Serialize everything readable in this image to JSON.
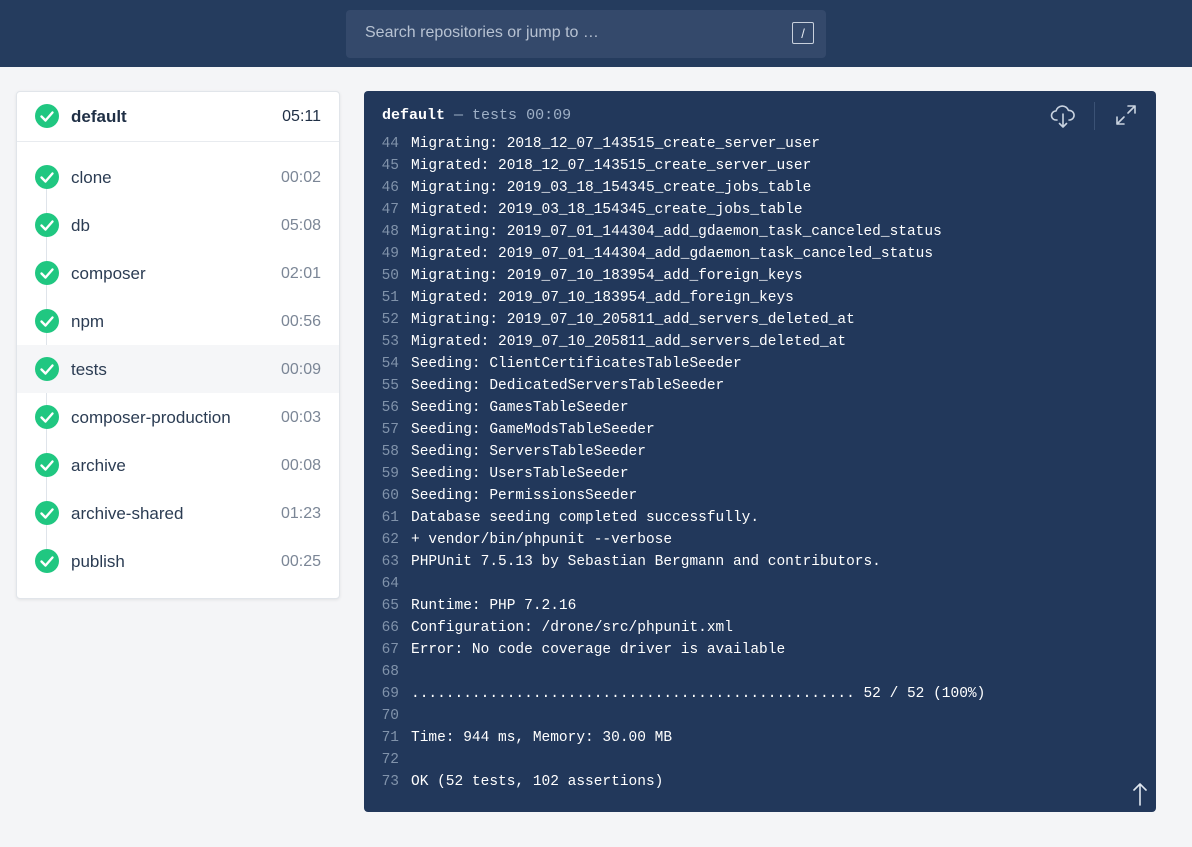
{
  "search": {
    "placeholder": "Search repositories or jump to …",
    "shortcut": "/"
  },
  "pipeline": {
    "name": "default",
    "duration": "05:11"
  },
  "steps": [
    {
      "name": "clone",
      "duration": "00:02"
    },
    {
      "name": "db",
      "duration": "05:08"
    },
    {
      "name": "composer",
      "duration": "02:01"
    },
    {
      "name": "npm",
      "duration": "00:56"
    },
    {
      "name": "tests",
      "duration": "00:09"
    },
    {
      "name": "composer-production",
      "duration": "00:03"
    },
    {
      "name": "archive",
      "duration": "00:08"
    },
    {
      "name": "archive-shared",
      "duration": "01:23"
    },
    {
      "name": "publish",
      "duration": "00:25"
    }
  ],
  "log": {
    "stage": "default",
    "separator": " — ",
    "step": "tests",
    "duration": "00:09",
    "lines": [
      {
        "n": "44",
        "t": "Migrating: 2018_12_07_143515_create_server_user"
      },
      {
        "n": "45",
        "t": "Migrated: 2018_12_07_143515_create_server_user"
      },
      {
        "n": "46",
        "t": "Migrating: 2019_03_18_154345_create_jobs_table"
      },
      {
        "n": "47",
        "t": "Migrated: 2019_03_18_154345_create_jobs_table"
      },
      {
        "n": "48",
        "t": "Migrating: 2019_07_01_144304_add_gdaemon_task_canceled_status"
      },
      {
        "n": "49",
        "t": "Migrated: 2019_07_01_144304_add_gdaemon_task_canceled_status"
      },
      {
        "n": "50",
        "t": "Migrating: 2019_07_10_183954_add_foreign_keys"
      },
      {
        "n": "51",
        "t": "Migrated: 2019_07_10_183954_add_foreign_keys"
      },
      {
        "n": "52",
        "t": "Migrating: 2019_07_10_205811_add_servers_deleted_at"
      },
      {
        "n": "53",
        "t": "Migrated: 2019_07_10_205811_add_servers_deleted_at"
      },
      {
        "n": "54",
        "t": "Seeding: ClientCertificatesTableSeeder"
      },
      {
        "n": "55",
        "t": "Seeding: DedicatedServersTableSeeder"
      },
      {
        "n": "56",
        "t": "Seeding: GamesTableSeeder"
      },
      {
        "n": "57",
        "t": "Seeding: GameModsTableSeeder"
      },
      {
        "n": "58",
        "t": "Seeding: ServersTableSeeder"
      },
      {
        "n": "59",
        "t": "Seeding: UsersTableSeeder"
      },
      {
        "n": "60",
        "t": "Seeding: PermissionsSeeder"
      },
      {
        "n": "61",
        "t": "Database seeding completed successfully."
      },
      {
        "n": "62",
        "t": "+ vendor/bin/phpunit --verbose"
      },
      {
        "n": "63",
        "t": "PHPUnit 7.5.13 by Sebastian Bergmann and contributors."
      },
      {
        "n": "64",
        "t": ""
      },
      {
        "n": "65",
        "t": "Runtime: PHP 7.2.16"
      },
      {
        "n": "66",
        "t": "Configuration: /drone/src/phpunit.xml"
      },
      {
        "n": "67",
        "t": "Error: No code coverage driver is available"
      },
      {
        "n": "68",
        "t": ""
      },
      {
        "n": "69",
        "t": "................................................... 52 / 52 (100%)"
      },
      {
        "n": "70",
        "t": ""
      },
      {
        "n": "71",
        "t": "Time: 944 ms, Memory: 30.00 MB"
      },
      {
        "n": "72",
        "t": ""
      },
      {
        "n": "73",
        "t": "OK (52 tests, 102 assertions)"
      }
    ]
  },
  "icons": {
    "status": "check-circle-icon",
    "download": "cloud-download-icon",
    "expand": "expand-icon",
    "scroll_top": "arrow-up-icon"
  },
  "colors": {
    "success": "#20c781",
    "header_bg": "#253c5e",
    "log_bg": "#22385b"
  }
}
